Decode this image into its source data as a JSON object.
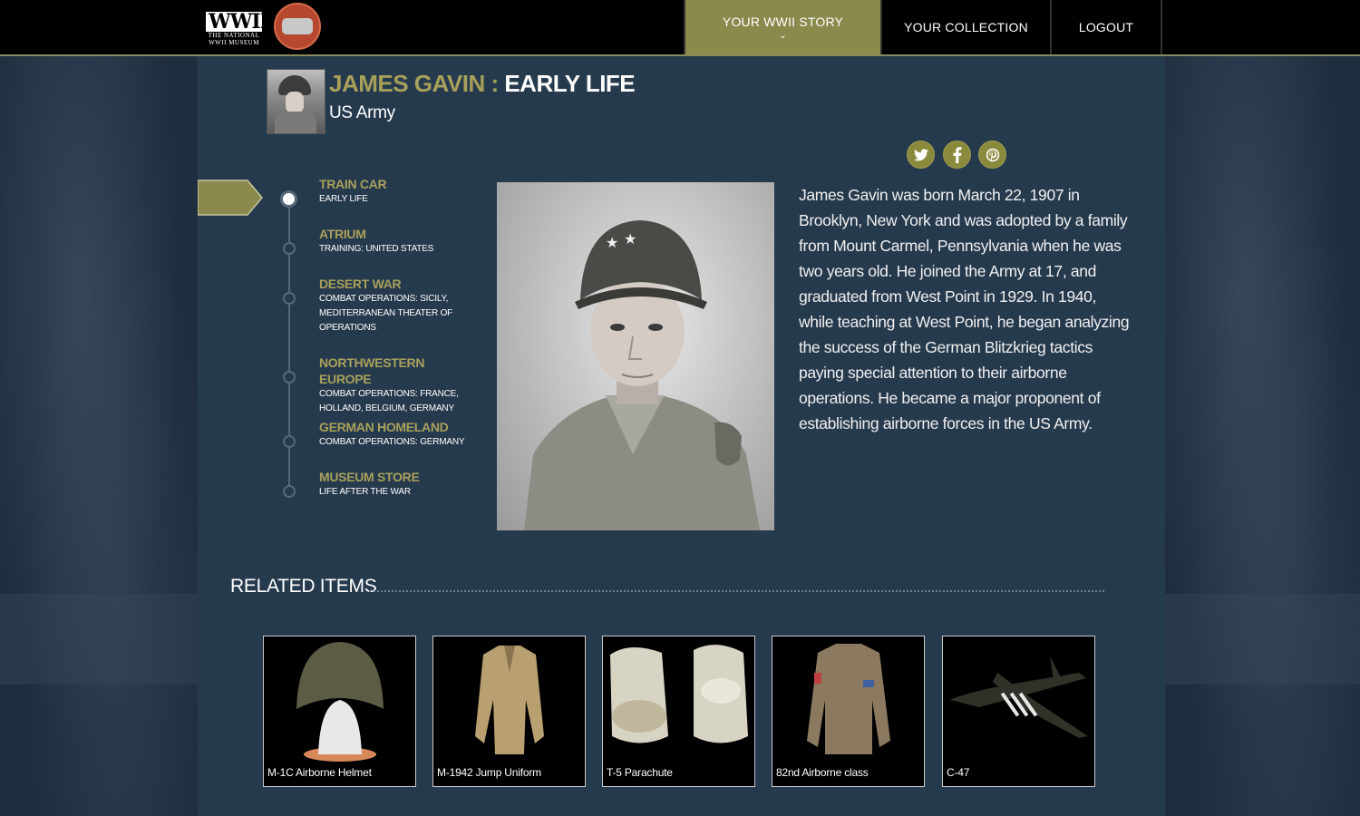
{
  "header": {
    "logo": {
      "mark": "WWII",
      "sub": "THE NATIONAL WWII MUSEUM"
    },
    "nav": [
      {
        "label": "YOUR WWII STORY",
        "active": true
      },
      {
        "label": "YOUR COLLECTION",
        "active": false
      },
      {
        "label": "LOGOUT",
        "active": false
      }
    ]
  },
  "profile": {
    "name": "JAMES GAVIN",
    "separator": " : ",
    "chapter": "EARLY LIFE",
    "branch": "US Army"
  },
  "social": {
    "icons": [
      "twitter-icon",
      "facebook-icon",
      "pinterest-icon"
    ]
  },
  "timeline": [
    {
      "title": "TRAIN CAR",
      "sub": "EARLY LIFE",
      "current": true
    },
    {
      "title": "ATRIUM",
      "sub": "TRAINING: UNITED STATES",
      "current": false
    },
    {
      "title": "DESERT WAR",
      "sub": "COMBAT OPERATIONS: SICILY, MEDITERRANEAN THEATER OF OPERATIONS",
      "current": false
    },
    {
      "title": "NORTHWESTERN EUROPE",
      "sub": "COMBAT OPERATIONS: FRANCE, HOLLAND, BELGIUM, GERMANY",
      "current": false
    },
    {
      "title": "GERMAN HOMELAND",
      "sub": "COMBAT OPERATIONS: GERMANY",
      "current": false
    },
    {
      "title": "MUSEUM STORE",
      "sub": "LIFE AFTER THE WAR",
      "current": false
    }
  ],
  "bio": "James Gavin was born March 22, 1907 in Brooklyn, New York and was adopted by a family from Mount Carmel, Pennsylvania when he was two years old. He joined the Army at 17, and graduated from West Point in 1929. In 1940, while teaching at West Point, he began analyzing the success of the German Blitzkrieg tactics paying special attention to their airborne operations. He became a major proponent of establishing airborne forces in the US Army.",
  "related": {
    "title": "RELATED ITEMS",
    "items": [
      {
        "caption": "M-1C Airborne Helmet"
      },
      {
        "caption": "M-1942 Jump Uniform"
      },
      {
        "caption": "T-5 Parachute"
      },
      {
        "caption": "82nd Airborne class"
      },
      {
        "caption": "C-47"
      }
    ]
  },
  "colors": {
    "accent": "#a8a05a",
    "nav_active": "#8a8a4c",
    "panel": "#263a4e"
  }
}
